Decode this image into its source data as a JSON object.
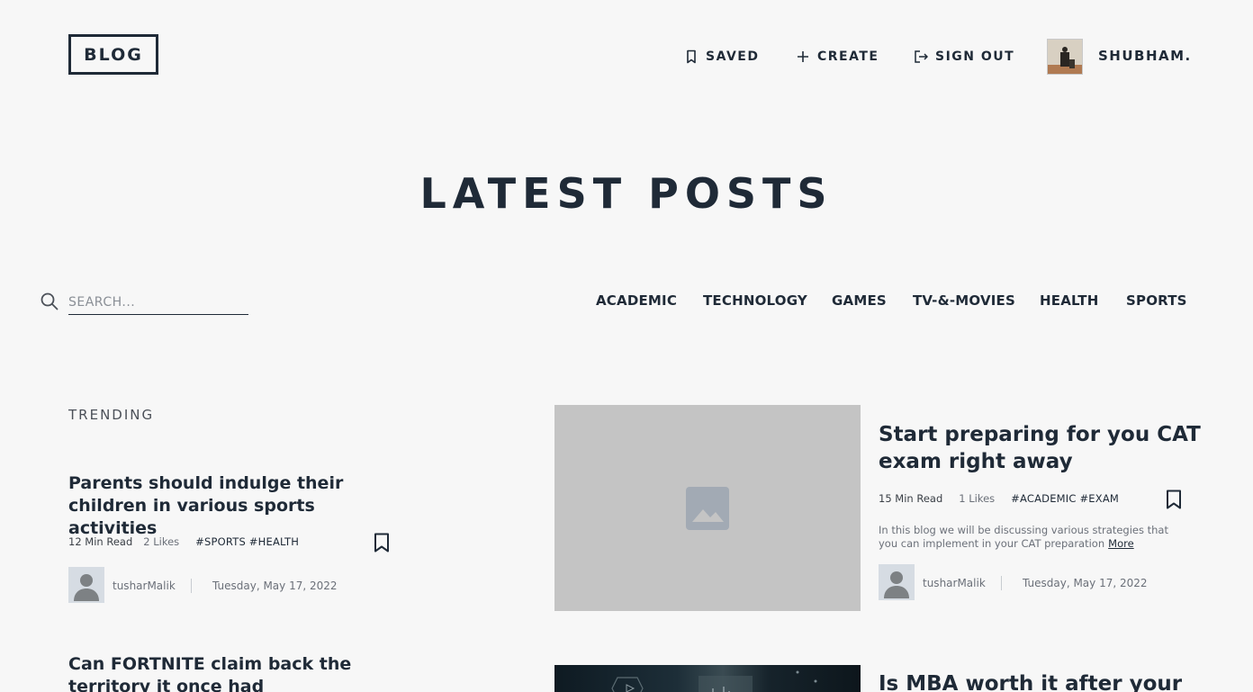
{
  "header": {
    "logo": "BLOG",
    "nav": {
      "saved": "SAVED",
      "create": "CREATE",
      "signout": "SIGN OUT"
    },
    "username": "SHUBHAM."
  },
  "page_title": "LATEST POSTS",
  "search": {
    "placeholder": "SEARCH...",
    "value": ""
  },
  "categories": [
    "ACADEMIC",
    "TECHNOLOGY",
    "GAMES",
    "TV-&-MOVIES",
    "HEALTH",
    "SPORTS"
  ],
  "trending": {
    "label": "TRENDING",
    "posts": [
      {
        "title": "Parents should indulge their children in various sports activities",
        "read_time": "12 Min Read",
        "likes": "2 Likes",
        "tags": "#SPORTS #HEALTH",
        "author": "tusharMalik",
        "date": "Tuesday, May 17, 2022"
      },
      {
        "title": "Can FORTNITE claim back the territory it once had"
      }
    ]
  },
  "featured": [
    {
      "title": "Start preparing for you CAT exam right away",
      "read_time": "15 Min Read",
      "likes": "1 Likes",
      "tags": "#ACADEMIC #EXAM",
      "excerpt": "In this blog we will be discussing various strategies that you can implement in your CAT preparation",
      "more": "More",
      "author": "tusharMalik",
      "date": "Tuesday, May 17, 2022"
    },
    {
      "title": "Is MBA worth it after your"
    }
  ]
}
